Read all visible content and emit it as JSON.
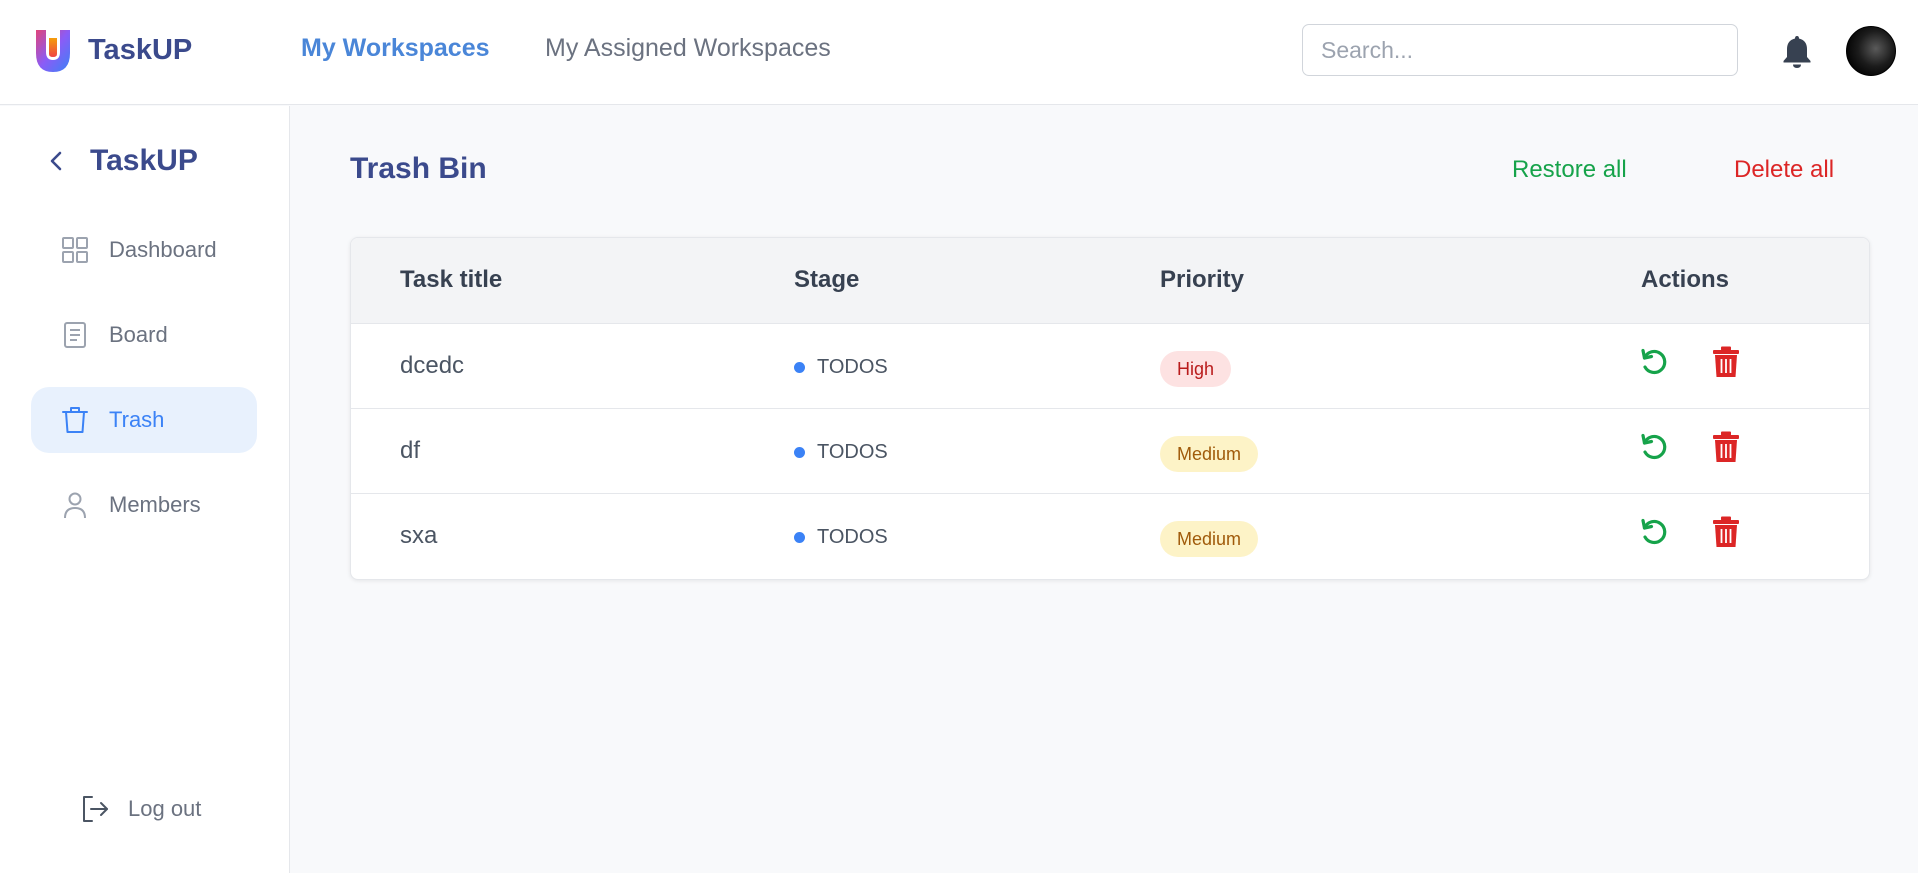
{
  "app": {
    "name": "TaskUP"
  },
  "nav": {
    "tabs": [
      {
        "label": "My Workspaces",
        "active": true
      },
      {
        "label": "My Assigned Workspaces",
        "active": false
      }
    ]
  },
  "search": {
    "placeholder": "Search...",
    "value": ""
  },
  "header": {
    "notification_icon": "bell-icon",
    "avatar_icon": "avatar"
  },
  "sidebar": {
    "title": "TaskUP",
    "back_icon": "chevron-left-icon",
    "items": [
      {
        "label": "Dashboard",
        "icon": "grid-icon",
        "active": false
      },
      {
        "label": "Board",
        "icon": "document-icon",
        "active": false
      },
      {
        "label": "Trash",
        "icon": "trash-icon",
        "active": true
      },
      {
        "label": "Members",
        "icon": "user-icon",
        "active": false
      }
    ],
    "logout_label": "Log out"
  },
  "main": {
    "title": "Trash Bin",
    "restore_all_label": "Restore all",
    "delete_all_label": "Delete all",
    "table": {
      "headers": [
        "Task title",
        "Stage",
        "Priority",
        "Actions"
      ],
      "rows": [
        {
          "title": "dcedc",
          "stage": "TODOS",
          "priority": "High"
        },
        {
          "title": "df",
          "stage": "TODOS",
          "priority": "Medium"
        },
        {
          "title": "sxa",
          "stage": "TODOS",
          "priority": "Medium"
        }
      ]
    }
  },
  "colors": {
    "brand": "#3b4a8c",
    "active_link": "#4a86d8",
    "restore": "#16a34a",
    "delete": "#dc2626",
    "stage_dot": "#3b82f6",
    "priority_high_bg": "#fde2e2",
    "priority_medium_bg": "#fdf3c7"
  }
}
